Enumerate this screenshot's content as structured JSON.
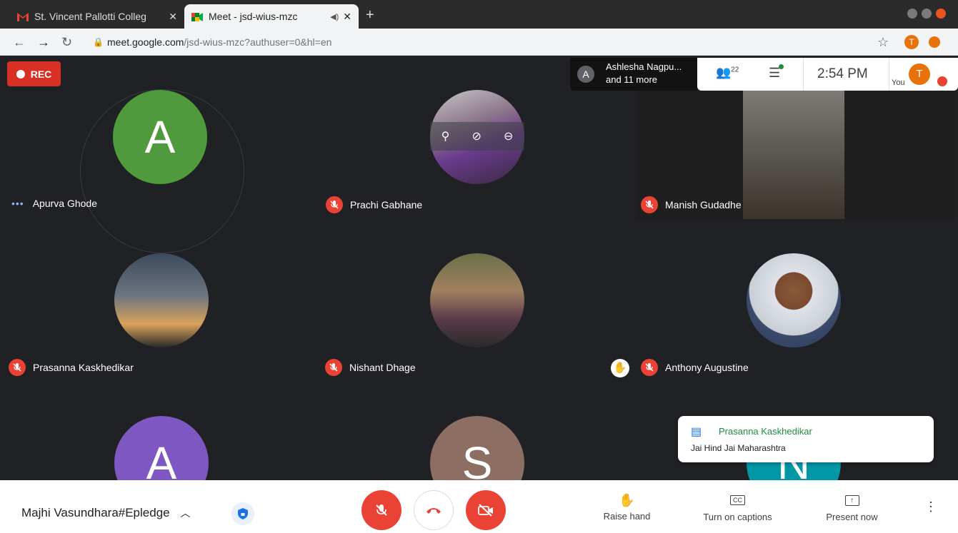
{
  "browser": {
    "tabs": [
      {
        "label": "St. Vincent Pallotti Colleg"
      },
      {
        "label": "Meet - jsd-wius-mzc"
      }
    ],
    "url_host": "meet.google.com",
    "url_path": "/jsd-wius-mzc?authuser=0&hl=en",
    "profile_initial": "T"
  },
  "meet": {
    "rec_label": "REC",
    "presenter_line1": "Ashlesha Nagpu...",
    "presenter_line2": "and 11 more",
    "presenter_initial": "A",
    "participant_count": "22",
    "clock": "2:54 PM",
    "you_label": "You",
    "you_initial": "T",
    "participants": [
      {
        "name": "Apurva Ghode",
        "initial": "A",
        "color": "#4f9a3c"
      },
      {
        "name": "Prachi Gabhane"
      },
      {
        "name": "Manish Gudadhe"
      },
      {
        "name": "Prasanna Kaskhedikar"
      },
      {
        "name": "Nishant Dhage"
      },
      {
        "name": "Anthony Augustine"
      },
      {
        "initial": "A",
        "color": "#7e57c2"
      },
      {
        "initial": "S",
        "color": "#8d6e63"
      },
      {
        "initial": "N",
        "color": "#0097a7"
      }
    ],
    "chat_notification": {
      "sender": "Prasanna Kaskhedikar",
      "message": "Jai Hind Jai Maharashtra"
    },
    "meeting_name": "Majhi Vasundhara#Epledge",
    "controls": {
      "raise_hand": "Raise hand",
      "captions": "Turn on captions",
      "present": "Present now"
    }
  }
}
